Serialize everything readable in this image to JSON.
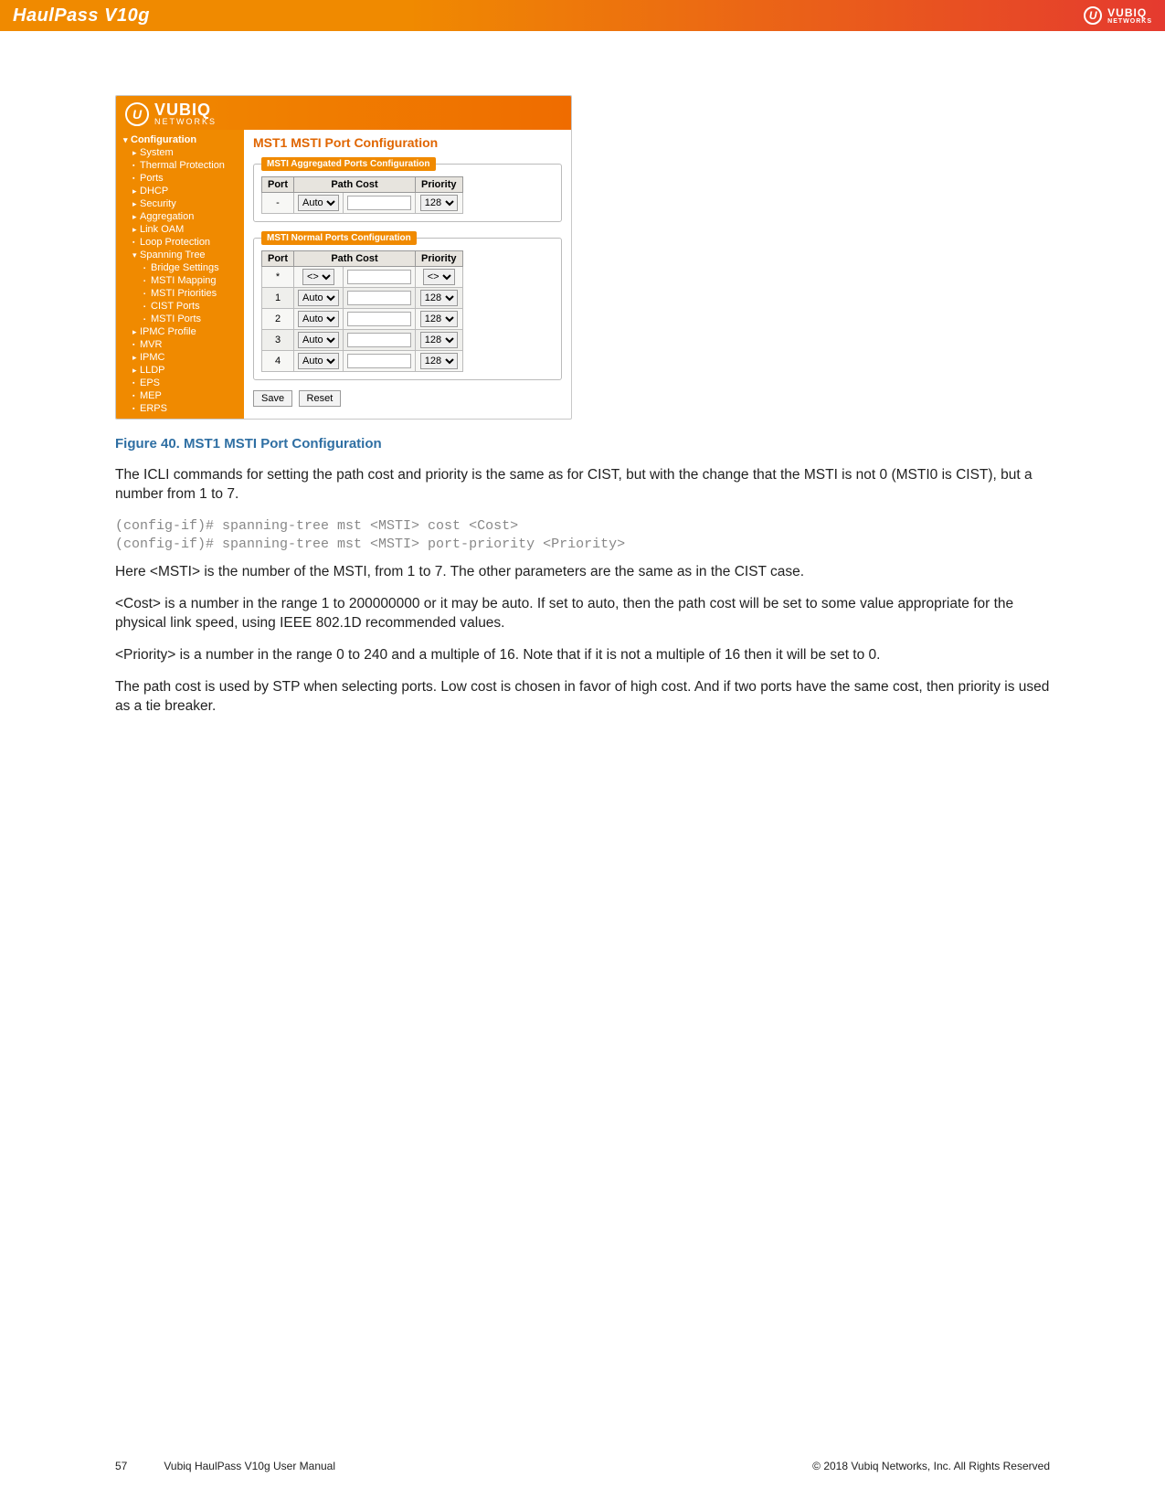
{
  "topbar": {
    "title": "HaulPass V10g",
    "logo_line1": "VUBIQ",
    "logo_line2": "NETWORKS"
  },
  "ui": {
    "brand_line1": "VUBIQ",
    "brand_line2": "NETWORKS",
    "sidebar": [
      {
        "label": "Configuration",
        "type": "exp",
        "bold": true,
        "cls": ""
      },
      {
        "label": "System",
        "type": "col",
        "cls": "sub"
      },
      {
        "label": "Thermal Protection",
        "type": "leaf",
        "cls": "sub"
      },
      {
        "label": "Ports",
        "type": "leaf",
        "cls": "sub"
      },
      {
        "label": "DHCP",
        "type": "col",
        "cls": "sub"
      },
      {
        "label": "Security",
        "type": "col",
        "cls": "sub"
      },
      {
        "label": "Aggregation",
        "type": "col",
        "cls": "sub"
      },
      {
        "label": "Link OAM",
        "type": "col",
        "cls": "sub"
      },
      {
        "label": "Loop Protection",
        "type": "leaf",
        "cls": "sub"
      },
      {
        "label": "Spanning Tree",
        "type": "exp",
        "cls": "sub"
      },
      {
        "label": "Bridge Settings",
        "type": "leaf",
        "cls": "sub2"
      },
      {
        "label": "MSTI Mapping",
        "type": "leaf",
        "cls": "sub2"
      },
      {
        "label": "MSTI Priorities",
        "type": "leaf",
        "cls": "sub2"
      },
      {
        "label": "CIST Ports",
        "type": "leaf",
        "cls": "sub2"
      },
      {
        "label": "MSTI Ports",
        "type": "leaf",
        "cls": "sub2"
      },
      {
        "label": "IPMC Profile",
        "type": "col",
        "cls": "sub"
      },
      {
        "label": "MVR",
        "type": "leaf",
        "cls": "sub"
      },
      {
        "label": "IPMC",
        "type": "col",
        "cls": "sub"
      },
      {
        "label": "LLDP",
        "type": "col",
        "cls": "sub"
      },
      {
        "label": "EPS",
        "type": "leaf",
        "cls": "sub"
      },
      {
        "label": "MEP",
        "type": "leaf",
        "cls": "sub"
      },
      {
        "label": "ERPS",
        "type": "leaf",
        "cls": "sub"
      }
    ],
    "main_title": "MST1 MSTI Port Configuration",
    "fieldset_agg": "MSTI Aggregated Ports Configuration",
    "fieldset_norm": "MSTI Normal Ports Configuration",
    "col_port": "Port",
    "col_pathcost": "Path Cost",
    "col_priority": "Priority",
    "agg_rows": [
      {
        "port": "-",
        "cost": "Auto",
        "prio": "128"
      }
    ],
    "norm_rows": [
      {
        "port": "*",
        "cost": "<>",
        "prio": "<>"
      },
      {
        "port": "1",
        "cost": "Auto",
        "prio": "128"
      },
      {
        "port": "2",
        "cost": "Auto",
        "prio": "128"
      },
      {
        "port": "3",
        "cost": "Auto",
        "prio": "128"
      },
      {
        "port": "4",
        "cost": "Auto",
        "prio": "128"
      }
    ],
    "save_label": "Save",
    "reset_label": "Reset"
  },
  "doc": {
    "figcap": "Figure 40. MST1 MSTI Port Configuration",
    "p1": "The ICLI commands for setting the path cost and priority is the same as for CIST, but with the change that the MSTI is not 0 (MSTI0 is CIST), but a number from 1 to 7.",
    "code": "(config-if)# spanning-tree mst <MSTI> cost <Cost>\n(config-if)# spanning-tree mst <MSTI> port-priority <Priority>",
    "p2": "Here <MSTI> is the number of the MSTI, from 1 to 7. The other parameters are the same as in the CIST case.",
    "p3": "<Cost> is a number in the range 1 to 200000000 or it may be auto. If set to auto, then the path cost will be set to some value appropriate for the physical link speed, using IEEE 802.1D recommended values.",
    "p4": "<Priority> is a number in the range 0 to 240 and a multiple of 16. Note that if it is not a multiple of 16 then it will be set to 0.",
    "p5": "The path cost is used by STP when selecting ports. Low cost is chosen in favor of high cost. And if two ports have the same cost, then priority is used as a tie breaker."
  },
  "footer": {
    "pagenum": "57",
    "manual": "Vubiq HaulPass V10g User Manual",
    "copyright": "© 2018 Vubiq Networks, Inc. All Rights Reserved"
  }
}
